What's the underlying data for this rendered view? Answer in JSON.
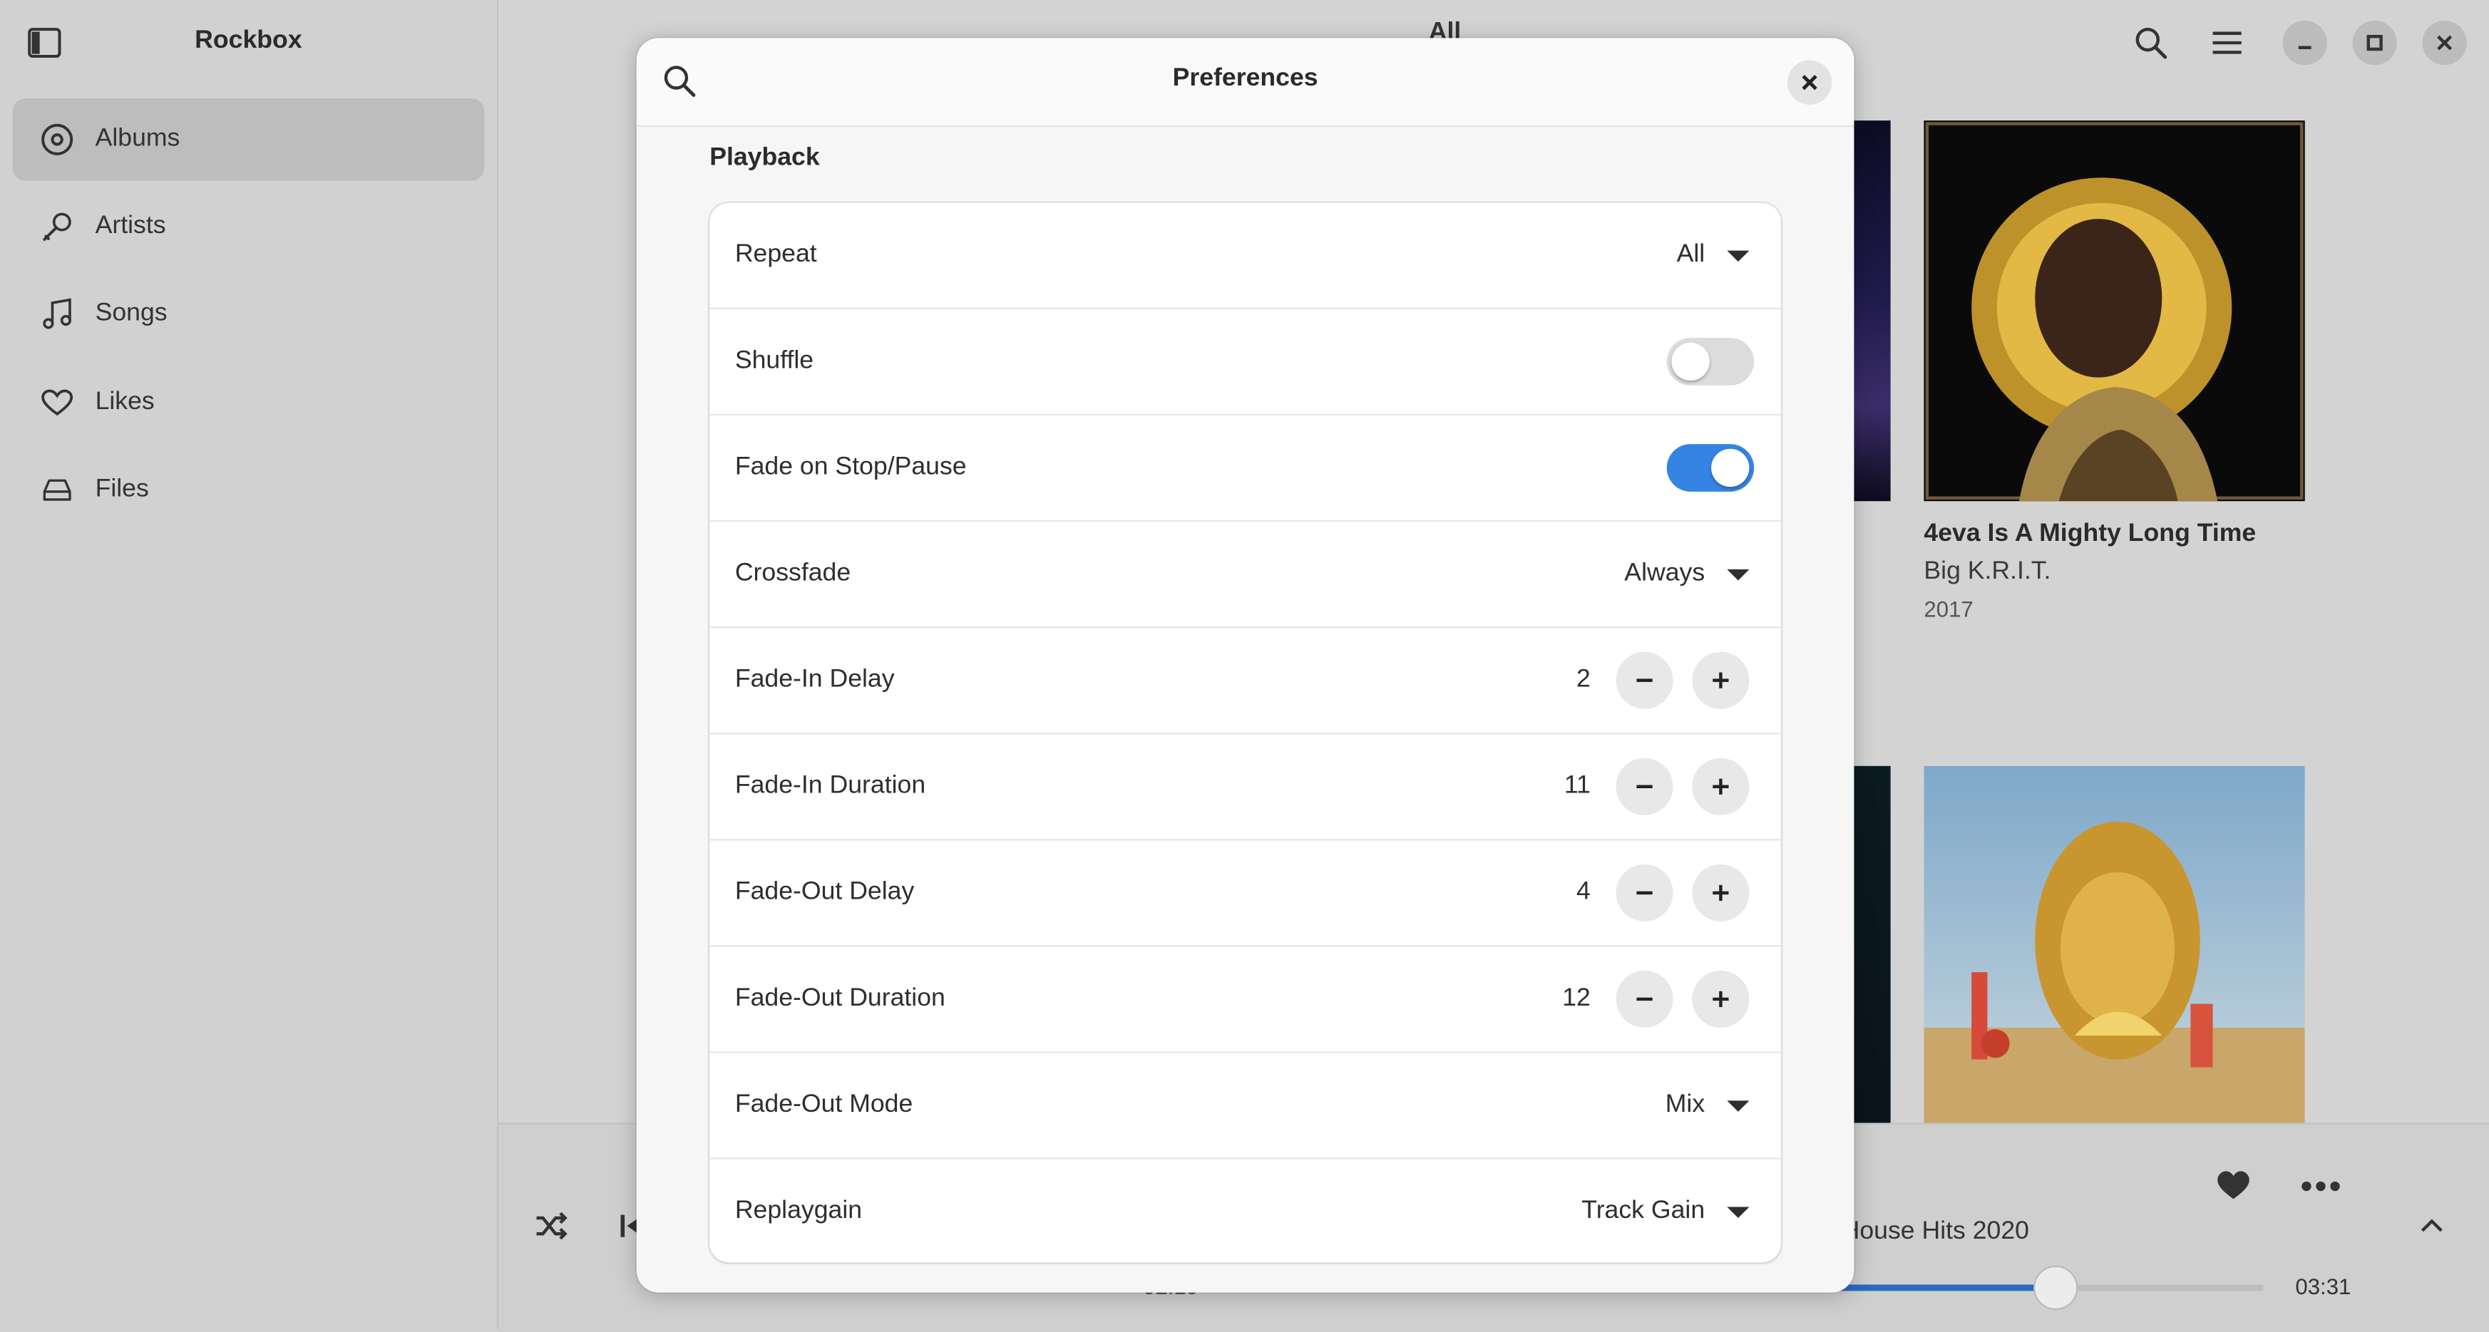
{
  "sidebar": {
    "app_title": "Rockbox",
    "items": [
      {
        "label": "Albums",
        "active": true
      },
      {
        "label": "Artists"
      },
      {
        "label": "Songs"
      },
      {
        "label": "Likes"
      },
      {
        "label": "Files"
      }
    ]
  },
  "main": {
    "title": "All",
    "albums": [
      {
        "title": "4eva Is A Mighty Long Time",
        "artist": "Big K.R.I.T.",
        "year": "2017"
      }
    ]
  },
  "player": {
    "album": "House Hits 2020",
    "elapsed": "02:19",
    "total": "03:31",
    "progress": 0.52
  },
  "preferences": {
    "title": "Preferences",
    "section": "Playback",
    "rows": {
      "repeat": {
        "label": "Repeat",
        "value": "All"
      },
      "shuffle": {
        "label": "Shuffle",
        "on": false
      },
      "fade_on_stop": {
        "label": "Fade on Stop/Pause",
        "on": true
      },
      "crossfade": {
        "label": "Crossfade",
        "value": "Always"
      },
      "fade_in_delay": {
        "label": "Fade-In Delay",
        "value": "2"
      },
      "fade_in_duration": {
        "label": "Fade-In Duration",
        "value": "11"
      },
      "fade_out_delay": {
        "label": "Fade-Out Delay",
        "value": "4"
      },
      "fade_out_duration": {
        "label": "Fade-Out Duration",
        "value": "12"
      },
      "fade_out_mode": {
        "label": "Fade-Out Mode",
        "value": "Mix"
      },
      "replaygain": {
        "label": "Replaygain",
        "value": "Track Gain"
      }
    }
  },
  "colors": {
    "accent": "#3584e4",
    "progress": "#2a6ac2"
  },
  "icons": [
    "sidebar-toggle-icon",
    "disc-icon",
    "microphone-icon",
    "music-note-icon",
    "heart-icon",
    "drive-icon",
    "search-icon",
    "menu-icon",
    "minimize-icon",
    "maximize-icon",
    "close-icon",
    "shuffle-icon",
    "previous-icon",
    "more-icon",
    "chevron-up-icon",
    "minus-icon",
    "plus-icon"
  ]
}
